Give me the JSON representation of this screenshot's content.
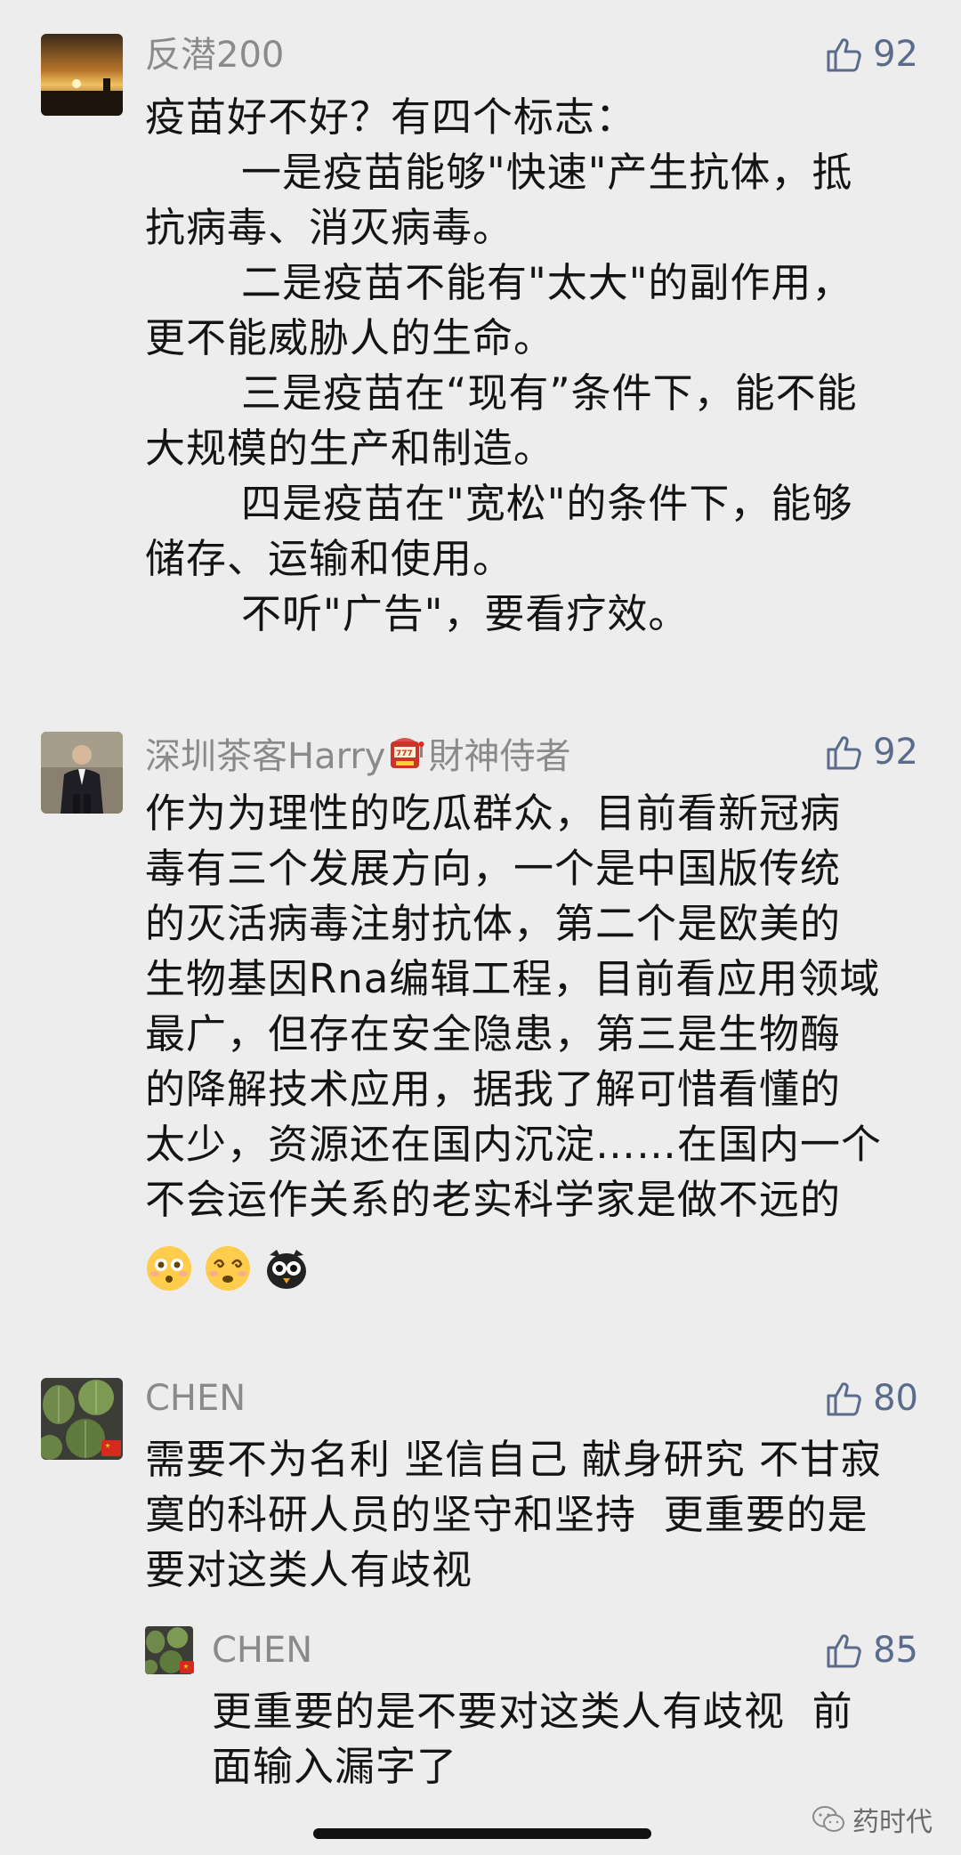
{
  "comments": [
    {
      "username": "反潜200",
      "likes": "92",
      "avatar": "sunset-photo",
      "lines": [
        {
          "text": "疫苗好不好？有四个标志：",
          "indent": false
        },
        {
          "text": "一是疫苗能够\"快速\"产生抗体，抵",
          "indent": true
        },
        {
          "text": "抗病毒、消灭病毒。",
          "indent": false
        },
        {
          "text": "二是疫苗不能有\"太大\"的副作用，",
          "indent": true
        },
        {
          "text": "更不能威胁人的生命。",
          "indent": false
        },
        {
          "text": "三是疫苗在“现有”条件下，能不能",
          "indent": true
        },
        {
          "text": "大规模的生产和制造。",
          "indent": false
        },
        {
          "text": "四是疫苗在\"宽松\"的条件下，能够",
          "indent": true
        },
        {
          "text": "储存、运输和使用。",
          "indent": false
        },
        {
          "text": "不听\"广告\"，要看疗效。",
          "indent": true
        }
      ]
    },
    {
      "username": "深圳茶客Harry",
      "username_suffix": "財神侍者",
      "username_icon": "slot-machine-icon",
      "likes": "92",
      "avatar": "man-in-suit-photo",
      "lines": [
        {
          "text": "作为为理性的吃瓜群众，目前看新冠病",
          "indent": false
        },
        {
          "text": "毒有三个发展方向，一个是中国版传统",
          "indent": false
        },
        {
          "text": "的灭活病毒注射抗体，第二个是欧美的",
          "indent": false
        },
        {
          "text": "生物基因Rna编辑工程，目前看应用领域",
          "indent": false
        },
        {
          "text": "最广，但存在安全隐患，第三是生物酶",
          "indent": false
        },
        {
          "text": "的降解技术应用，据我了解可惜看懂的",
          "indent": false
        },
        {
          "text": "太少，资源还在国内沉淀……在国内一个",
          "indent": false
        },
        {
          "text": "不会运作关系的老实科学家是做不远的",
          "indent": false
        }
      ],
      "emojis": [
        "flushed-face-icon",
        "dizzy-face-icon",
        "black-bird-face-icon"
      ]
    },
    {
      "username": "CHEN",
      "likes": "80",
      "avatar": "cactus-photo",
      "lines": [
        {
          "text": "需要不为名利 坚信自己 献身研究 不甘寂",
          "indent": false
        },
        {
          "text": "寞的科研人员的坚守和坚持  更重要的是",
          "indent": false
        },
        {
          "text": "要对这类人有歧视",
          "indent": false
        }
      ]
    },
    {
      "username": "CHEN",
      "likes": "85",
      "avatar": "cactus-photo",
      "is_reply": true,
      "lines": [
        {
          "text": "更重要的是不要对这类人有歧视  前",
          "indent": false
        },
        {
          "text": "面输入漏字了",
          "indent": false
        }
      ]
    }
  ],
  "watermark": {
    "text": "药时代",
    "icon": "wechat-icon"
  },
  "colors": {
    "background": "#ededed",
    "username": "#8a8a8a",
    "like": "#5a6b8c",
    "text": "#141414"
  }
}
